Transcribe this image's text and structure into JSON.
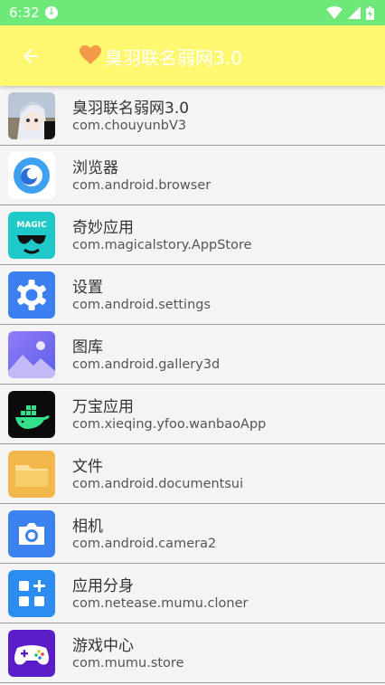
{
  "status_bar": {
    "time": "6:32"
  },
  "app_bar": {
    "title": "臭羽联名弱网3.0"
  },
  "apps": [
    {
      "name": "臭羽联名弱网3.0",
      "package": "com.chouyunbV3",
      "icon": "anime-avatar-icon"
    },
    {
      "name": "浏览器",
      "package": "com.android.browser",
      "icon": "browser-icon"
    },
    {
      "name": "奇妙应用",
      "package": "com.magicalstory.AppStore",
      "icon": "magic-app-icon"
    },
    {
      "name": "设置",
      "package": "com.android.settings",
      "icon": "settings-gear-icon"
    },
    {
      "name": "图库",
      "package": "com.android.gallery3d",
      "icon": "gallery-icon"
    },
    {
      "name": "万宝应用",
      "package": "com.xieqing.yfoo.wanbaoApp",
      "icon": "docker-whale-icon"
    },
    {
      "name": "文件",
      "package": "com.android.documentsui",
      "icon": "folder-icon"
    },
    {
      "name": "相机",
      "package": "com.android.camera2",
      "icon": "camera-icon"
    },
    {
      "name": "应用分身",
      "package": "com.netease.mumu.cloner",
      "icon": "app-cloner-icon"
    },
    {
      "name": "游戏中心",
      "package": "com.mumu.store",
      "icon": "gamepad-icon"
    }
  ],
  "colors": {
    "status_bar": "#6ee878",
    "app_bar": "#fdf86f",
    "heart": "#f2994a"
  }
}
